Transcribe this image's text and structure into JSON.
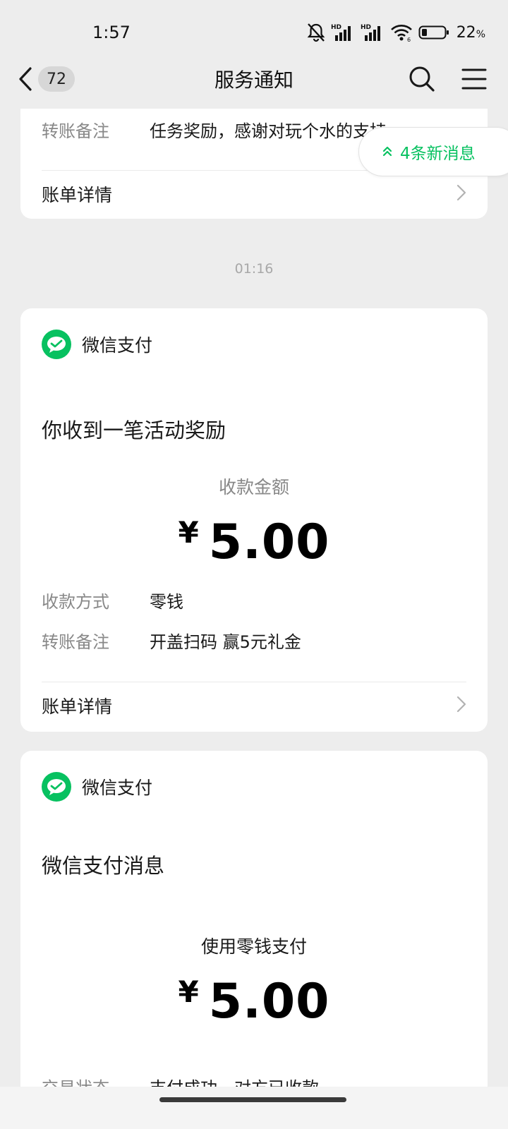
{
  "status": {
    "time": "1:57",
    "battery_percent": "22",
    "battery_unit": "%"
  },
  "nav": {
    "unread_count": "72",
    "title": "服务通知"
  },
  "new_messages_pill": "4条新消息",
  "card1": {
    "remark_label": "转账备注",
    "remark_value": "任务奖励，感谢对玩个水的支持",
    "detail_label": "账单详情"
  },
  "timestamp": "01:16",
  "card2": {
    "sender": "微信支付",
    "title": "你收到一笔活动奖励",
    "amount_label": "收款金额",
    "currency": "¥",
    "amount": "5.00",
    "method_label": "收款方式",
    "method_value": "零钱",
    "remark_label": "转账备注",
    "remark_value": "开盖扫码 赢5元礼金",
    "detail_label": "账单详情"
  },
  "card3": {
    "sender": "微信支付",
    "title": "微信支付消息",
    "amount_label": "使用零钱支付",
    "currency": "¥",
    "amount": "5.00",
    "status_label": "交易状态",
    "status_value": "支付成功，对方已收款"
  },
  "colors": {
    "accent": "#07c160",
    "background": "#ededed",
    "card": "#ffffff"
  }
}
